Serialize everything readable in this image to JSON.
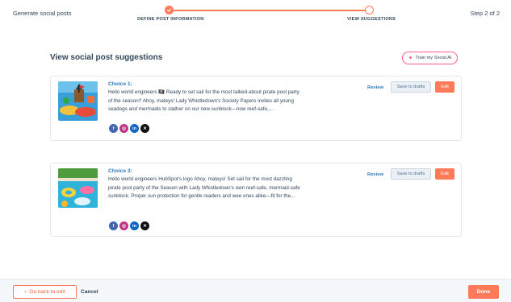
{
  "header": {
    "title": "Generate social posts",
    "step_indicator": "Step 2 of 2",
    "steps": [
      {
        "label": "DEFINE POST INFORMATION",
        "state": "done"
      },
      {
        "label": "VIEW SUGGESTIONS",
        "state": "current"
      }
    ],
    "accent_color": "#ff7a59"
  },
  "main": {
    "title": "View social post suggestions",
    "train_button": "Train my Social AI",
    "suggestions": [
      {
        "choice_label": "Choice 1:",
        "text": "Hello world engineers 🏴‍☠️ Ready to set sail for the most talked-about pirate pool party of the season? Ahoy, mateys! Lady Whistledown's Society Papers invites all young seadogs and mermaids to slather on our new sunblock—now reef-safe,...",
        "image": "pirate-pool-party-photo",
        "networks": [
          "facebook",
          "instagram",
          "linkedin",
          "x"
        ],
        "review_label": "Review",
        "save_label": "Save to drafts",
        "edit_label": "Edit"
      },
      {
        "choice_label": "Choice 3:",
        "text": "Hello world engineers HubSpot's logo Ahoy, mateys! Set sail for the most dazzling pirate pool party of the Season with Lady Whistledown's own reef-safe, mermaid-safe sunblock. Proper sun protection for gentle readers and wee ones alike—fit for the...",
        "image": "pool-floats-photo",
        "networks": [
          "facebook",
          "instagram",
          "linkedin",
          "x"
        ],
        "review_label": "Review",
        "save_label": "Save to drafts",
        "edit_label": "Edit"
      }
    ]
  },
  "footer": {
    "back_label": "Go back to edit",
    "cancel_label": "Cancel",
    "done_label": "Done"
  }
}
